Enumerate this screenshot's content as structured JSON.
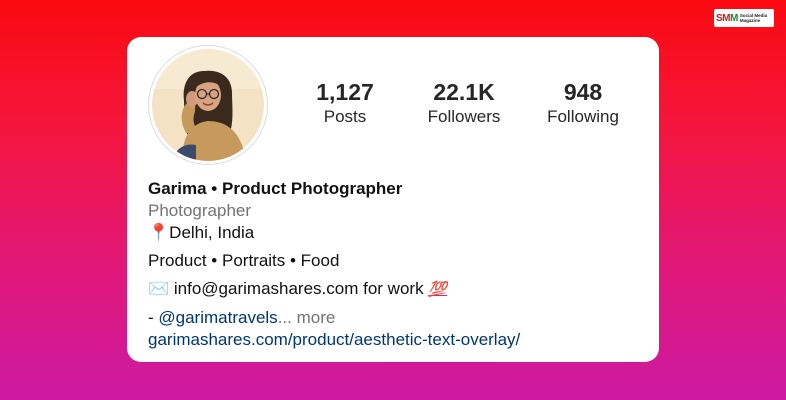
{
  "brand": {
    "mark_left": "SM",
    "mark_right": "M",
    "mark_text": "Social Media Magazine"
  },
  "profile": {
    "stats": [
      {
        "value": "1,127",
        "label": "Posts"
      },
      {
        "value": "22.1K",
        "label": "Followers"
      },
      {
        "value": "948",
        "label": "Following"
      }
    ],
    "name": "Garima • Product Photographer",
    "category": "Photographer",
    "location_pin": "📍",
    "location": "Delhi, India",
    "specialties": "Product • Portraits • Food",
    "email_icon": "✉️",
    "email_text": " info@garimashares.com for work ",
    "hundred_emoji": "💯",
    "mention_prefix": "- ",
    "mention": "@garimatravels",
    "more": "... more",
    "website": "garimashares.com/product/aesthetic-text-overlay/"
  }
}
